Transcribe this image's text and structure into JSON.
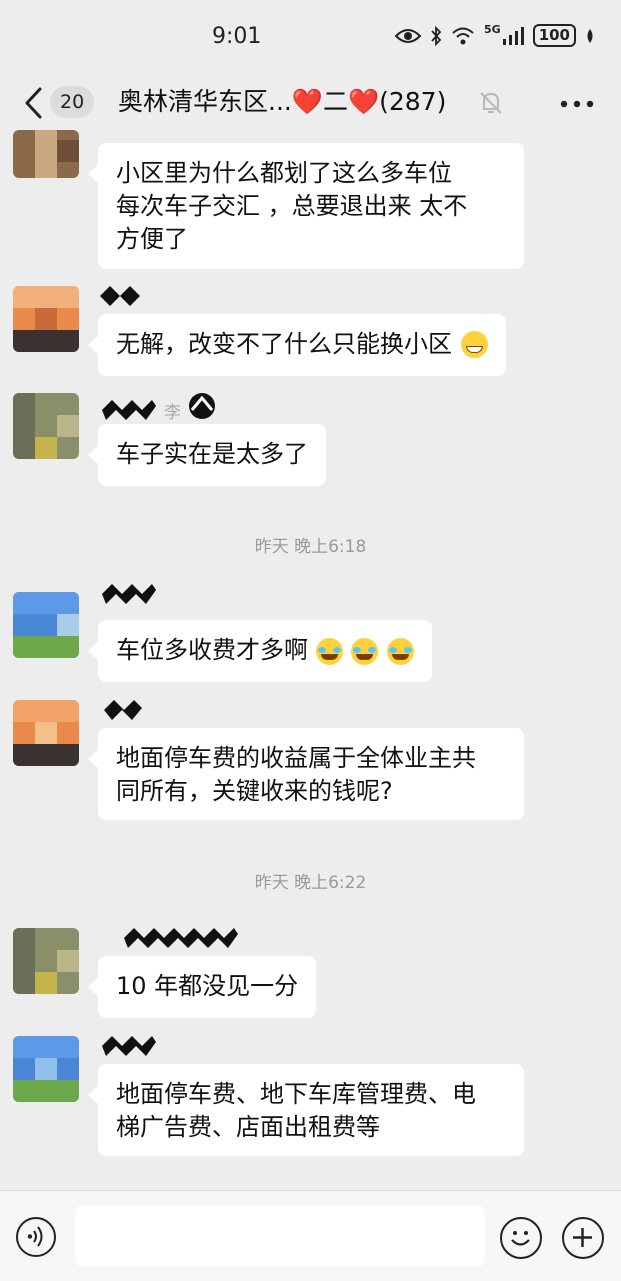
{
  "status_bar": {
    "time": "9:01",
    "network": "5G",
    "battery": "100"
  },
  "nav": {
    "unread_count": "20",
    "title": "奥林清华东区...❤️二❤️(287)"
  },
  "messages": [
    {
      "text": "小区里为什么都划了这么多车位\n每次车子交汇 ，总要退出来 太不\n方便了"
    },
    {
      "text": "无解，改变不了什么只能换小区",
      "emoji": "grin"
    },
    {
      "text": "车子实在是太多了"
    },
    {
      "text": "车位多收费才多啊",
      "emoji": "cry-laugh x3"
    },
    {
      "text": "地面停车费的收益属于全体业主共\n同所有，关键收来的钱呢?"
    },
    {
      "text": "10 年都没见一分"
    },
    {
      "text": "地面停车费、地下车库管理费、电\n梯广告费、店面出租费等"
    }
  ],
  "timestamps": [
    "昨天 晚上6:18",
    "昨天 晚上6:22"
  ],
  "nick_fragments": [
    "李"
  ],
  "colors": {
    "background": "#ededed",
    "bubble": "#ffffff",
    "timestamp": "#9a9a9a"
  }
}
